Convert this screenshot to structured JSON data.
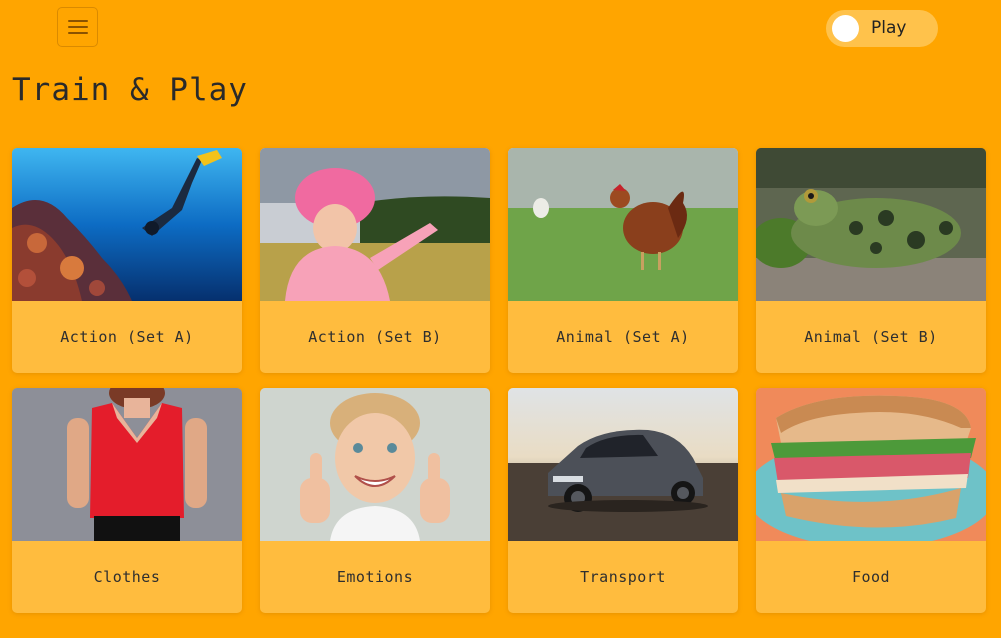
{
  "header": {
    "menu_icon": "hamburger-icon",
    "mode_toggle_label": "Play"
  },
  "page": {
    "title": "Train & Play"
  },
  "categories": [
    {
      "label": "Action (Set A)",
      "image": "scuba-diver-coral-reef"
    },
    {
      "label": "Action (Set B)",
      "image": "child-pointing-field"
    },
    {
      "label": "Animal (Set A)",
      "image": "hen-on-grass"
    },
    {
      "label": "Animal (Set B)",
      "image": "frog-on-rock"
    },
    {
      "label": "Clothes",
      "image": "red-sleeveless-blouse"
    },
    {
      "label": "Emotions",
      "image": "girl-thumbs-up"
    },
    {
      "label": "Transport",
      "image": "grey-hatchback-car"
    },
    {
      "label": "Food",
      "image": "sandwich-on-plate"
    }
  ],
  "colors": {
    "background": "#FFA500",
    "card": "#FFBC3E",
    "toggle": "#FFC24B"
  }
}
